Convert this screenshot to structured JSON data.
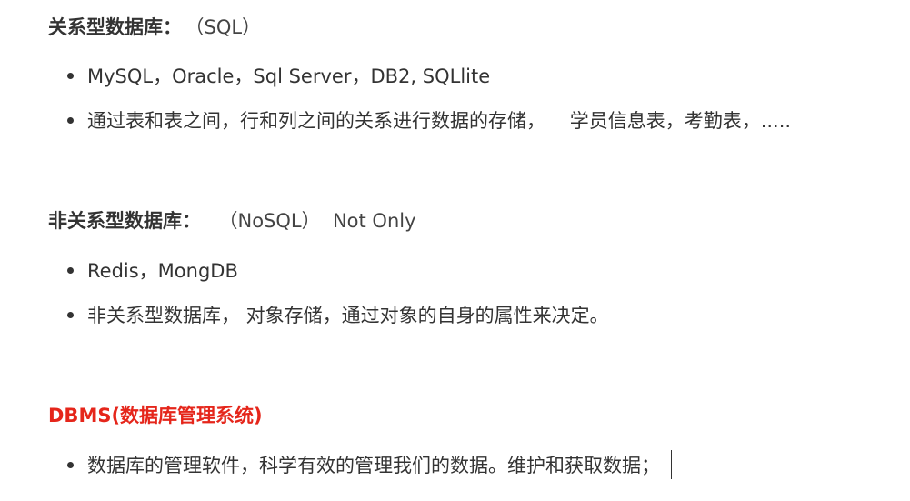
{
  "section1": {
    "title": "关系型数据库：",
    "tail": "（SQL）",
    "items": [
      "MySQL，Oracle，Sql Server，DB2, SQLlite",
      "通过表和表之间，行和列之间的关系进行数据的存储，    学员信息表，考勤表，....."
    ]
  },
  "section2": {
    "title": "非关系型数据库：",
    "tail": "（NoSQL）  Not Only",
    "items": [
      "Redis，MongDB",
      "非关系型数据库， 对象存储，通过对象的自身的属性来决定。"
    ]
  },
  "section3": {
    "title": "DBMS(数据库管理系统)",
    "items": [
      "数据库的管理软件，科学有效的管理我们的数据。维护和获取数据；"
    ]
  },
  "colors": {
    "text": "#333333",
    "accent_red": "#e5261b"
  }
}
